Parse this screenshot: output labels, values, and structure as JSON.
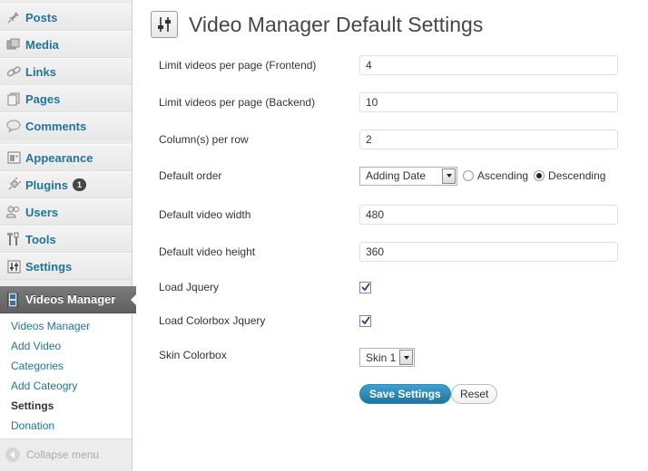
{
  "sidebar": {
    "items": [
      {
        "label": "Posts",
        "icon": "pin-icon"
      },
      {
        "label": "Media",
        "icon": "media-icon"
      },
      {
        "label": "Links",
        "icon": "link-icon"
      },
      {
        "label": "Pages",
        "icon": "pages-icon"
      },
      {
        "label": "Comments",
        "icon": "comment-icon"
      },
      {
        "label": "Appearance",
        "icon": "appearance-icon"
      },
      {
        "label": "Plugins",
        "icon": "plugin-icon",
        "badge": "1"
      },
      {
        "label": "Users",
        "icon": "users-icon"
      },
      {
        "label": "Tools",
        "icon": "tools-icon"
      },
      {
        "label": "Settings",
        "icon": "settings-icon"
      }
    ],
    "active": {
      "label": "Videos Manager",
      "icon": "film-icon"
    },
    "submenu": [
      "Videos Manager",
      "Add Video",
      "Categories",
      "Add Cateogry",
      "Settings",
      "Donation"
    ],
    "submenu_current": "Settings",
    "collapse_label": "Collapse menu"
  },
  "main": {
    "title": "Video Manager Default Settings",
    "fields": {
      "limit_frontend": {
        "label": "Limit videos per page (Frontend)",
        "value": "4"
      },
      "limit_backend": {
        "label": "Limit videos per page (Backend)",
        "value": "10"
      },
      "columns": {
        "label": "Column(s) per row",
        "value": "2"
      },
      "order": {
        "label": "Default order",
        "selected": "Adding Date",
        "asc_label": "Ascending",
        "desc_label": "Descending",
        "direction": "Descending"
      },
      "width": {
        "label": "Default video width",
        "value": "480"
      },
      "height": {
        "label": "Default video height",
        "value": "360"
      },
      "jquery": {
        "label": "Load Jquery",
        "checked": true
      },
      "colorbox": {
        "label": "Load Colorbox Jquery",
        "checked": true
      },
      "skin": {
        "label": "Skin Colorbox",
        "selected": "Skin 1"
      }
    },
    "save_label": "Save Settings",
    "reset_label": "Reset"
  }
}
